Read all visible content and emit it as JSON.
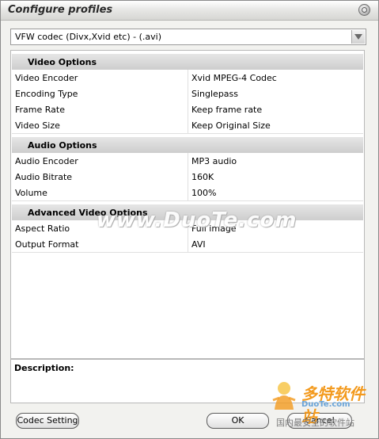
{
  "window": {
    "title": "Configure profiles"
  },
  "profile": {
    "selected": "VFW codec (Divx,Xvid etc) - (.avi)"
  },
  "sections": [
    {
      "title": "Video Options",
      "rows": [
        {
          "key": "Video Encoder",
          "value": "Xvid MPEG-4 Codec"
        },
        {
          "key": "Encoding Type",
          "value": "Singlepass"
        },
        {
          "key": "Frame Rate",
          "value": "Keep frame rate"
        },
        {
          "key": "Video Size",
          "value": "Keep Original Size"
        }
      ]
    },
    {
      "title": "Audio Options",
      "rows": [
        {
          "key": "Audio Encoder",
          "value": "MP3 audio"
        },
        {
          "key": "Audio Bitrate",
          "value": "160K"
        },
        {
          "key": "Volume",
          "value": "100%"
        }
      ]
    },
    {
      "title": "Advanced Video Options",
      "rows": [
        {
          "key": "Aspect Ratio",
          "value": "Full image"
        },
        {
          "key": "Output Format",
          "value": "AVI"
        }
      ]
    }
  ],
  "description": {
    "label": "Description:"
  },
  "buttons": {
    "codec": "Codec Setting",
    "ok": "OK",
    "cancel": "Cancel"
  },
  "watermarks": {
    "center": "www.DuoTe.com",
    "logo_big": "多特软件站",
    "logo_small": "DuoTe.com",
    "logo_tag": "国内最安全的软件站"
  }
}
